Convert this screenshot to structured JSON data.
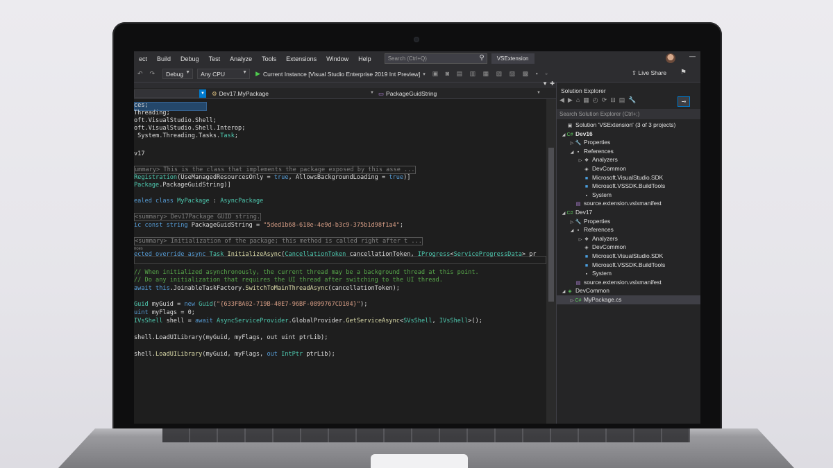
{
  "menu": {
    "items": [
      "ect",
      "Build",
      "Debug",
      "Test",
      "Analyze",
      "Tools",
      "Extensions",
      "Window",
      "Help"
    ],
    "search_placeholder": "Search (Ctrl+Q)",
    "project_name": "VSExtension"
  },
  "toolbar": {
    "config": "Debug",
    "platform": "Any CPU",
    "run_label": "Current Instance [Visual Studio Enterprise 2019 Int Preview]",
    "live_share": "Live Share"
  },
  "editor": {
    "nav_class": "Dev17.MyPackage",
    "nav_member": "PackageGuidString"
  },
  "code_lines": [
    [
      [
        "ces;",
        "pl"
      ]
    ],
    [
      [
        "Threading;",
        "pl"
      ]
    ],
    [
      [
        "oft.VisualStudio.",
        "pl"
      ],
      [
        "Shell",
        "pl"
      ],
      [
        ";",
        "pl"
      ]
    ],
    [
      [
        "oft.VisualStudio.Shell.Interop;",
        "pl"
      ]
    ],
    [
      [
        " System.Threading.Tasks.",
        "pl"
      ],
      [
        "Task",
        "ty"
      ],
      [
        ";",
        "pl"
      ]
    ],
    [
      [
        "v17",
        "pl"
      ]
    ],
    [
      [
        "ummary> This is the class that implements the package exposed by this asse ...",
        "collapsed"
      ]
    ],
    [
      [
        "Registration",
        "ty"
      ],
      [
        "(UseManagedResourcesOnly = ",
        "pl"
      ],
      [
        "true",
        "kw"
      ],
      [
        ", AllowsBackgroundLoading = ",
        "pl"
      ],
      [
        "true",
        "kw"
      ],
      [
        ")]",
        "pl"
      ]
    ],
    [
      [
        "Package",
        "ty"
      ],
      [
        ".",
        "pl"
      ],
      [
        "PackageGuidString",
        "pl"
      ],
      [
        ")]",
        "pl"
      ]
    ],
    [
      [
        "ealed class ",
        "kw"
      ],
      [
        "MyPackage",
        "ty"
      ],
      [
        " : ",
        "pl"
      ],
      [
        "AsyncPackage",
        "ty"
      ]
    ],
    [
      [
        "<summary> Dev17Package GUID string.",
        "collapsed"
      ]
    ],
    [
      [
        "ic const string ",
        "kw"
      ],
      [
        "PackageGuidString",
        "pl"
      ],
      [
        " = ",
        "pl"
      ],
      [
        "\"5ded1b68-618e-4e9d-b3c9-375b1d98f1a4\"",
        "st"
      ],
      [
        ";",
        "pl"
      ]
    ],
    [
      [
        "<summary> Initialization of the package; this method is called right after t ...",
        "collapsed"
      ]
    ],
    [
      [
        "nces",
        "hint"
      ]
    ],
    [
      [
        "ected override async ",
        "kw"
      ],
      [
        "Task",
        "ty"
      ],
      [
        " ",
        "pl"
      ],
      [
        "InitializeAsync",
        "fn"
      ],
      [
        "(",
        "pl"
      ],
      [
        "CancellationToken",
        "ty"
      ],
      [
        " cancellationToken, ",
        "pl"
      ],
      [
        "IProgress",
        "ty"
      ],
      [
        "<",
        "pl"
      ],
      [
        "ServiceProgressData",
        "ty"
      ],
      [
        "> pr",
        "pl"
      ]
    ],
    [
      [
        "// When initialized asynchronously, the current thread may be a background thread at this point.",
        "cm"
      ]
    ],
    [
      [
        "// Do any initialization that requires the UI thread after switching to the UI thread.",
        "cm"
      ]
    ],
    [
      [
        "await this",
        "kw"
      ],
      [
        ".JoinableTaskFactory.",
        "pl"
      ],
      [
        "SwitchToMainThreadAsync",
        "fn"
      ],
      [
        "(cancellationToken);",
        "pl"
      ]
    ],
    [
      [
        "Guid",
        "ty"
      ],
      [
        " myGuid = ",
        "pl"
      ],
      [
        "new ",
        "kw"
      ],
      [
        "Guid",
        "ty"
      ],
      [
        "(",
        "pl"
      ],
      [
        "\"{633FBA02-719B-40E7-96BF-0899767CD104}\"",
        "st"
      ],
      [
        ");",
        "pl"
      ]
    ],
    [
      [
        "uint",
        "kw"
      ],
      [
        " myFlags = 0;",
        "pl"
      ]
    ],
    [
      [
        "IVsShell",
        "ty"
      ],
      [
        " shell = ",
        "pl"
      ],
      [
        "await ",
        "kw"
      ],
      [
        "AsyncServiceProvider",
        "ty"
      ],
      [
        ".GlobalProvider.",
        "pl"
      ],
      [
        "GetServiceAsync",
        "fn"
      ],
      [
        "<",
        "pl"
      ],
      [
        "SVsShell",
        "ty"
      ],
      [
        ", ",
        "pl"
      ],
      [
        "IVsShell",
        "ty"
      ],
      [
        ">();",
        "pl"
      ]
    ],
    [
      [
        "shell.LoadUILibrary(myGuid, myFlags, out uint ptrLib);",
        "pl"
      ]
    ],
    [
      [
        "shell.",
        "pl"
      ],
      [
        "LoadUILibrary",
        "fn"
      ],
      [
        "(myGuid, myFlags, ",
        "pl"
      ],
      [
        "out ",
        "kw"
      ],
      [
        "IntPtr",
        "ty"
      ],
      [
        " ptrLib);",
        "pl"
      ]
    ]
  ],
  "solution_explorer": {
    "title": "Solution Explorer",
    "search_placeholder": "Search Solution Explorer (Ctrl+;)",
    "nodes": [
      {
        "label": "Solution 'VSExtension' (3 of 3 projects)",
        "icon": "solution-icon",
        "glyph": "▣",
        "color": "#c8c8c8",
        "depth": 0,
        "twisty": ""
      },
      {
        "label": "Dev16",
        "icon": "csharp-project-icon",
        "glyph": "C#",
        "color": "#5bc45b",
        "depth": 0,
        "twisty": "◢",
        "bold": true
      },
      {
        "label": "Properties",
        "icon": "wrench-icon",
        "glyph": "🔧",
        "color": "#c8c8c8",
        "depth": 1,
        "twisty": "▷"
      },
      {
        "label": "References",
        "icon": "references-icon",
        "glyph": "▪",
        "color": "#c8c8c8",
        "depth": 1,
        "twisty": "◢"
      },
      {
        "label": "Analyzers",
        "icon": "analyzers-icon",
        "glyph": "❖",
        "color": "#c8c8c8",
        "depth": 2,
        "twisty": "▷"
      },
      {
        "label": "DevCommon",
        "icon": "shared-project-icon",
        "glyph": "◈",
        "color": "#c8c8c8",
        "depth": 2,
        "twisty": ""
      },
      {
        "label": "Microsoft.VisualStudio.SDK",
        "icon": "package-icon",
        "glyph": "■",
        "color": "#4a9fe0",
        "depth": 2,
        "twisty": ""
      },
      {
        "label": "Microsoft.VSSDK.BuildTools",
        "icon": "package-icon",
        "glyph": "■",
        "color": "#4a9fe0",
        "depth": 2,
        "twisty": ""
      },
      {
        "label": "System",
        "icon": "assembly-icon",
        "glyph": "▪",
        "color": "#c8c8c8",
        "depth": 2,
        "twisty": ""
      },
      {
        "label": "source.extension.vsixmanifest",
        "icon": "manifest-icon",
        "glyph": "▤",
        "color": "#b180d7",
        "depth": 1,
        "twisty": ""
      },
      {
        "label": "Dev17",
        "icon": "csharp-project-icon",
        "glyph": "C#",
        "color": "#5bc45b",
        "depth": 0,
        "twisty": "◢"
      },
      {
        "label": "Properties",
        "icon": "wrench-icon",
        "glyph": "🔧",
        "color": "#c8c8c8",
        "depth": 1,
        "twisty": "▷"
      },
      {
        "label": "References",
        "icon": "references-icon",
        "glyph": "▪",
        "color": "#c8c8c8",
        "depth": 1,
        "twisty": "◢"
      },
      {
        "label": "Analyzers",
        "icon": "analyzers-icon",
        "glyph": "❖",
        "color": "#c8c8c8",
        "depth": 2,
        "twisty": "▷"
      },
      {
        "label": "DevCommon",
        "icon": "shared-project-icon",
        "glyph": "◈",
        "color": "#c8c8c8",
        "depth": 2,
        "twisty": ""
      },
      {
        "label": "Microsoft.VisualStudio.SDK",
        "icon": "package-icon",
        "glyph": "■",
        "color": "#4a9fe0",
        "depth": 2,
        "twisty": ""
      },
      {
        "label": "Microsoft.VSSDK.BuildTools",
        "icon": "package-icon",
        "glyph": "■",
        "color": "#4a9fe0",
        "depth": 2,
        "twisty": ""
      },
      {
        "label": "System",
        "icon": "assembly-icon",
        "glyph": "▪",
        "color": "#c8c8c8",
        "depth": 2,
        "twisty": ""
      },
      {
        "label": "source.extension.vsixmanifest",
        "icon": "manifest-icon",
        "glyph": "▤",
        "color": "#b180d7",
        "depth": 1,
        "twisty": ""
      },
      {
        "label": "DevCommon",
        "icon": "shared-project-icon",
        "glyph": "◈",
        "color": "#5bc45b",
        "depth": 0,
        "twisty": "◢"
      },
      {
        "label": "MyPackage.cs",
        "icon": "csharp-file-icon",
        "glyph": "C#",
        "color": "#5bc45b",
        "depth": 1,
        "twisty": "▷",
        "selected": true
      }
    ]
  },
  "colors": {
    "accent": "#007acc",
    "keyword": "#569cd6",
    "type": "#4ec9b0",
    "string": "#d69d85",
    "comment": "#57a64a"
  }
}
